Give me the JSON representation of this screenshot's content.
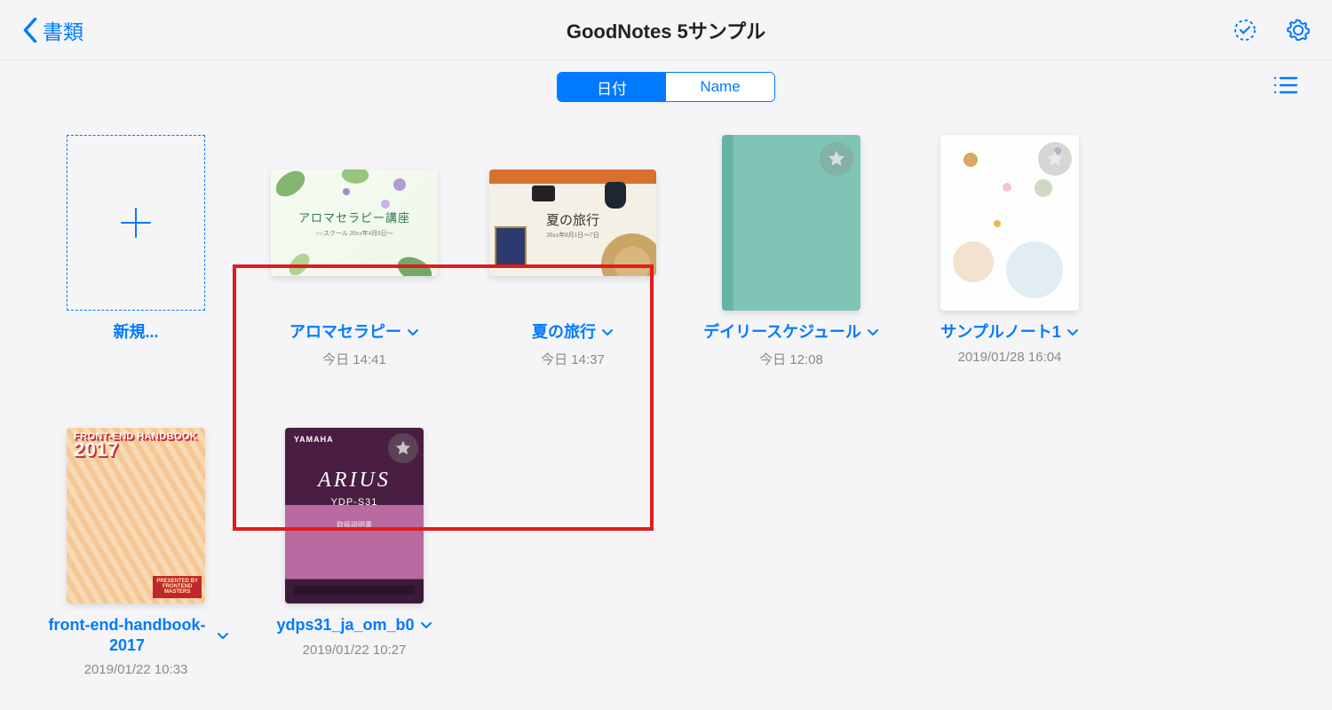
{
  "header": {
    "back_label": "書類",
    "title": "GoodNotes 5サンプル"
  },
  "sort": {
    "option_date": "日付",
    "option_name": "Name",
    "active": "date"
  },
  "new_item": {
    "label": "新規..."
  },
  "items": [
    {
      "title": "アロマセラピー",
      "timestamp": "今日 14:41",
      "cover": {
        "kind": "aroma",
        "headline": "アロマセラピー講座",
        "sub": "○○スクール  20xx年4月8日～"
      }
    },
    {
      "title": "夏の旅行",
      "timestamp": "今日 14:37",
      "cover": {
        "kind": "travel",
        "headline": "夏の旅行",
        "sub": "20xx年8月1日～7日"
      }
    },
    {
      "title": "デイリースケジュール",
      "timestamp": "今日 12:08",
      "cover": {
        "kind": "teal"
      }
    },
    {
      "title": "サンプルノート1",
      "timestamp": "2019/01/28 16:04",
      "cover": {
        "kind": "dots"
      }
    },
    {
      "title": "front-end-handbook-2017",
      "timestamp": "2019/01/22 10:33",
      "cover": {
        "kind": "feh",
        "headline": "FRONT-END HANDBOOK",
        "year": "2017",
        "tag1": "PRESENTED BY",
        "tag2": "FRONTEND",
        "tag3": "MASTERS"
      }
    },
    {
      "title": "ydps31_ja_om_b0",
      "timestamp": "2019/01/22 10:27",
      "cover": {
        "kind": "arius",
        "brand": "YAMAHA",
        "name": "ARIUS",
        "model": "YDP-S31",
        "sub": "取扱説明書"
      }
    }
  ]
}
